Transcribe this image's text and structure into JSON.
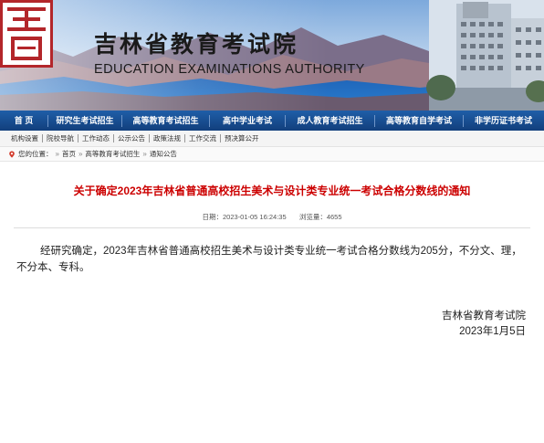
{
  "header": {
    "title_cn": "吉林省教育考试院",
    "title_en": "EDUCATION EXAMINATIONS AUTHORITY",
    "logo_char": "吉"
  },
  "nav": {
    "items": [
      {
        "label": "首 页"
      },
      {
        "label": "研究生考试招生"
      },
      {
        "label": "高等教育考试招生"
      },
      {
        "label": "高中学业考试"
      },
      {
        "label": "成人教育考试招生"
      },
      {
        "label": "高等教育自学考试"
      },
      {
        "label": "非学历证书考试"
      }
    ]
  },
  "subnav": {
    "items": [
      {
        "label": "机构设置"
      },
      {
        "label": "院校导航"
      },
      {
        "label": "工作动态"
      },
      {
        "label": "公示公告"
      },
      {
        "label": "政策法规"
      },
      {
        "label": "工作交流"
      },
      {
        "label": "预决算公开"
      }
    ]
  },
  "breadcrumb": {
    "prefix": "您的位置：",
    "items": [
      {
        "label": "首页"
      },
      {
        "label": "高等教育考试招生"
      },
      {
        "label": "通知公告"
      }
    ]
  },
  "article": {
    "title": "关于确定2023年吉林省普通高校招生美术与设计类专业统一考试合格分数线的通知",
    "date_label": "日期：",
    "date": "2023-01-05 16:24:35",
    "views_label": "浏览量：",
    "views": "4655",
    "body": "经研究确定，2023年吉林省普通高校招生美术与设计类专业统一考试合格分数线为205分，不分文、理，不分本、专科。",
    "signature_org": "吉林省教育考试院",
    "signature_date": "2023年1月5日"
  },
  "colors": {
    "nav_bg": "#1a4f93",
    "title_red": "#cc0000",
    "logo_red": "#b3262a"
  },
  "icons": {
    "location": "location-pin-icon"
  }
}
